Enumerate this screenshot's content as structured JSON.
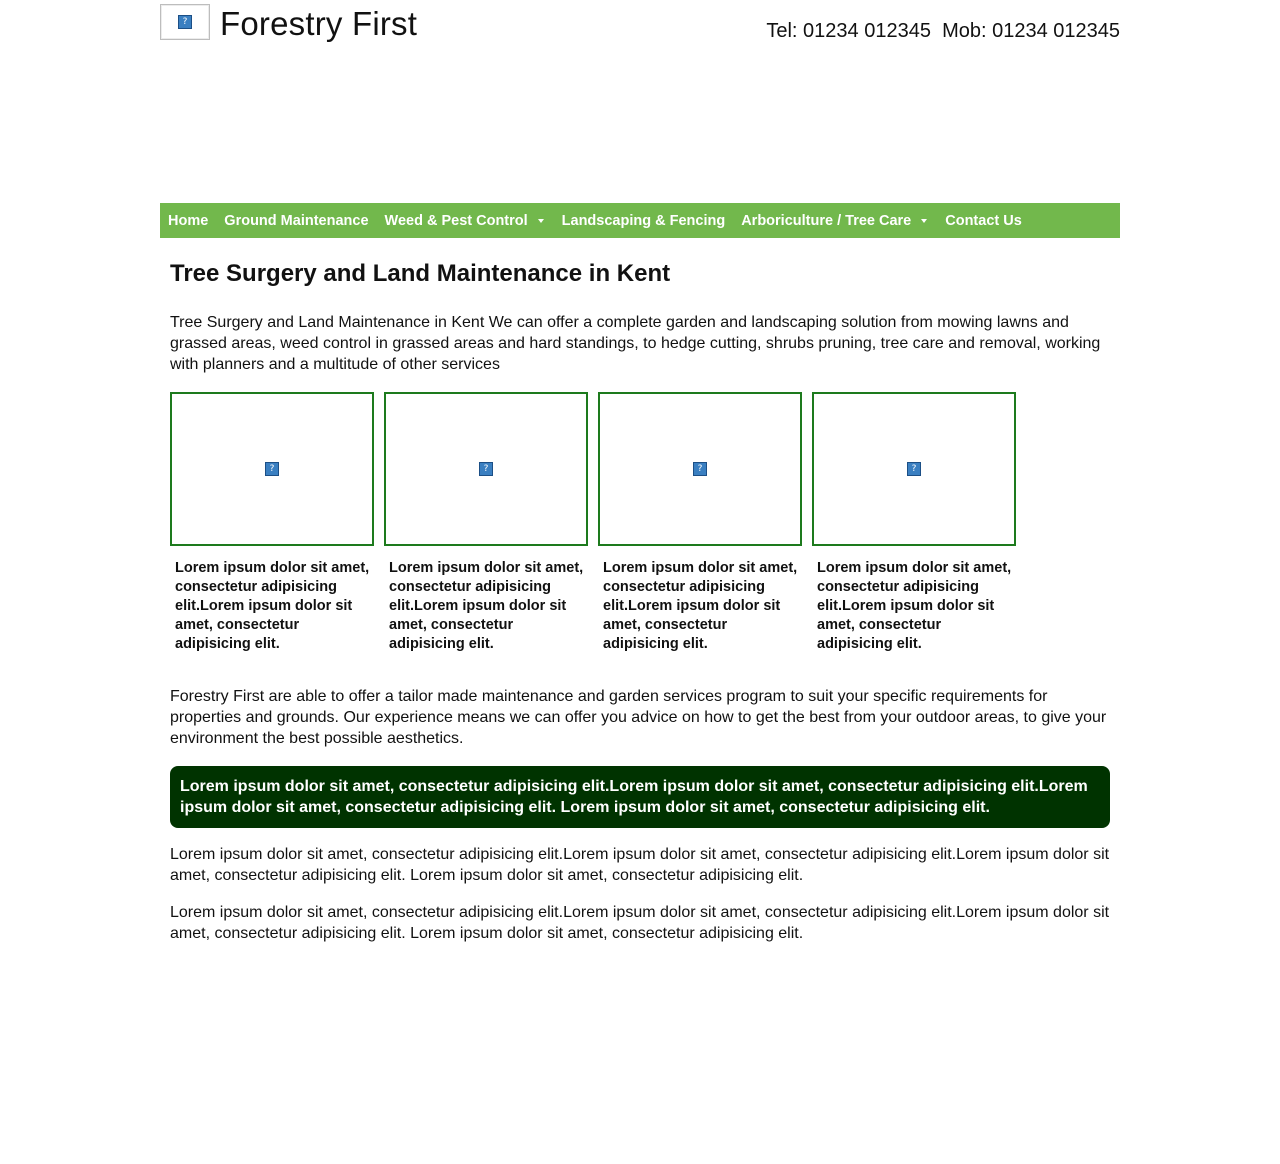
{
  "header": {
    "site_title": "Forestry First",
    "phones": "Tel: 01234 012345  Mob: 01234 012345",
    "logo_glyph": "?"
  },
  "nav": {
    "items": [
      {
        "label": "Home",
        "dropdown": false
      },
      {
        "label": "Ground Maintenance",
        "dropdown": false
      },
      {
        "label": "Weed & Pest Control",
        "dropdown": true
      },
      {
        "label": "Landscaping & Fencing",
        "dropdown": false
      },
      {
        "label": "Arboriculture / Tree Care",
        "dropdown": true
      },
      {
        "label": "Contact Us",
        "dropdown": false
      }
    ],
    "color": "#72b84c"
  },
  "main": {
    "title": "Tree Surgery and Land Maintenance in Kent",
    "intro": "Tree Surgery and Land Maintenance in Kent We can offer a complete garden and landscaping solution from mowing lawns and grassed areas, weed control in grassed areas and hard standings, to hedge cutting, shrubs pruning, tree care and removal, working with planners and a multitude of other services",
    "cards": [
      {
        "text": "Lorem ipsum dolor sit amet, consectetur adipisicing elit.Lorem ipsum dolor sit amet, consectetur adipisicing elit.",
        "image_glyph": "?"
      },
      {
        "text": "Lorem ipsum dolor sit amet, consectetur adipisicing elit.Lorem ipsum dolor sit amet, consectetur adipisicing elit.",
        "image_glyph": "?"
      },
      {
        "text": "Lorem ipsum dolor sit amet, consectetur adipisicing elit.Lorem ipsum dolor sit amet, consectetur adipisicing elit.",
        "image_glyph": "?"
      },
      {
        "text": "Lorem ipsum dolor sit amet, consectetur adipisicing elit.Lorem ipsum dolor sit amet, consectetur adipisicing elit.",
        "image_glyph": "?"
      }
    ],
    "services": "Forestry First are able to offer a tailor made maintenance and garden services program to suit your specific requirements for properties and grounds. Our experience means we can offer you advice on how to get the best from your outdoor areas, to give your environment the best possible aesthetics.",
    "highlight": "Lorem ipsum dolor sit amet, consectetur adipisicing elit.Lorem ipsum dolor sit amet, consectetur adipisicing elit.Lorem ipsum dolor sit amet, consectetur adipisicing elit. Lorem ipsum dolor sit amet, consectetur adipisicing elit.",
    "paragraph_2": "Lorem ipsum dolor sit amet, consectetur adipisicing elit.Lorem ipsum dolor sit amet, consectetur adipisicing elit.Lorem ipsum dolor sit amet, consectetur adipisicing elit. Lorem ipsum dolor sit amet, consectetur adipisicing elit.",
    "paragraph_3": "Lorem ipsum dolor sit amet, consectetur adipisicing elit.Lorem ipsum dolor sit amet, consectetur adipisicing elit.Lorem ipsum dolor sit amet, consectetur adipisicing elit. Lorem ipsum dolor sit amet, consectetur adipisicing elit."
  },
  "colors": {
    "highlight_bg": "#003300",
    "card_border": "#1d7a1d"
  }
}
